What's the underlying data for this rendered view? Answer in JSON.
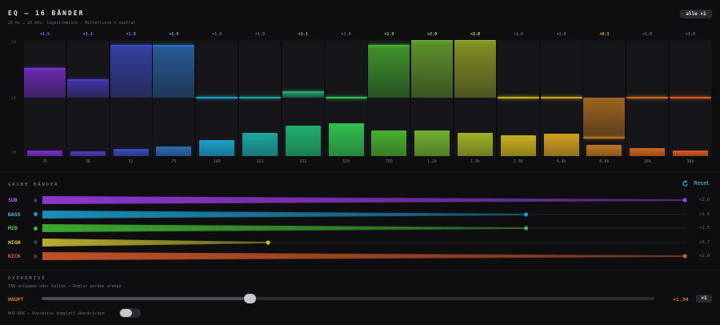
{
  "header": {
    "title": "EQ — 16 BÄNDER",
    "subtitle": "20 Hz … 20 kHz, logarithmisch — Mittellinie = neutral",
    "all_button": "alle ×1"
  },
  "eq": {
    "axis": {
      "top": "×2",
      "mid": "×1",
      "bottom": "×0"
    },
    "bands": [
      {
        "freq": "25",
        "gain": 1.5,
        "gain_label": "×1.5",
        "meter": 0.05,
        "color": "#7b2fd0",
        "label_color": "#a66bff"
      },
      {
        "freq": "36",
        "gain": 1.3,
        "gain_label": "×1.3",
        "meter": 0.04,
        "color": "#4a3cc0",
        "label_color": "#8a7bff"
      },
      {
        "freq": "52",
        "gain": 1.9,
        "gain_label": "×1.9",
        "meter": 0.06,
        "color": "#3a4bbf",
        "label_color": "#7a8cff"
      },
      {
        "freq": "75",
        "gain": 1.9,
        "gain_label": "×1.9",
        "meter": 0.08,
        "color": "#2a6bb5",
        "label_color": "#5ab0f0"
      },
      {
        "freq": "140",
        "gain": 1.0,
        "gain_label": "×1.0",
        "meter": 0.14,
        "color": "#1aa0c8",
        "label_color": "#6b6b75"
      },
      {
        "freq": "221",
        "gain": 1.0,
        "gain_label": "×1.0",
        "meter": 0.2,
        "color": "#1aa8a0",
        "label_color": "#6b6b75"
      },
      {
        "freq": "331",
        "gain": 1.1,
        "gain_label": "×1.1",
        "meter": 0.26,
        "color": "#20b070",
        "label_color": "#5ae09a"
      },
      {
        "freq": "510",
        "gain": 1.0,
        "gain_label": "×1.0",
        "meter": 0.28,
        "color": "#30c050",
        "label_color": "#6b6b75"
      },
      {
        "freq": "785",
        "gain": 1.9,
        "gain_label": "×1.9",
        "meter": 0.22,
        "color": "#48b030",
        "label_color": "#7ae050"
      },
      {
        "freq": "1.2k",
        "gain": 2.0,
        "gain_label": "×2.0",
        "meter": 0.22,
        "color": "#70b030",
        "label_color": "#a0e050"
      },
      {
        "freq": "1.9k",
        "gain": 2.0,
        "gain_label": "×2.0",
        "meter": 0.2,
        "color": "#a0b028",
        "label_color": "#d0e050"
      },
      {
        "freq": "2.9k",
        "gain": 1.0,
        "gain_label": "×1.0",
        "meter": 0.18,
        "color": "#c8b020",
        "label_color": "#6b6b75"
      },
      {
        "freq": "4.4k",
        "gain": 1.0,
        "gain_label": "×1.0",
        "meter": 0.19,
        "color": "#d0a020",
        "label_color": "#6b6b75"
      },
      {
        "freq": "6.8k",
        "gain": 0.3,
        "gain_label": "×0.3",
        "meter": 0.1,
        "color": "#c07820",
        "label_color": "#f0a030"
      },
      {
        "freq": "10k",
        "gain": 1.0,
        "gain_label": "×1.0",
        "meter": 0.07,
        "color": "#d06820",
        "label_color": "#6b6b75"
      },
      {
        "freq": "16k",
        "gain": 1.0,
        "gain_label": "×1.0",
        "meter": 0.05,
        "color": "#e05a20",
        "label_color": "#6b6b75"
      }
    ]
  },
  "groups": {
    "title": "GROBE BÄNDER",
    "reset_label": "Reset",
    "reset_color": "#4fc3e8",
    "rows": [
      {
        "label": "SUB",
        "value": 2.0,
        "value_label": "×2.0",
        "color": "#9a3ae0",
        "label_color": "#b060ff",
        "dot": "#3a3a42"
      },
      {
        "label": "BASS",
        "value": 1.5,
        "value_label": "×1.5",
        "color": "#1a9ac8",
        "label_color": "#4fb8e8",
        "dot": "#1a9ac8"
      },
      {
        "label": "MID",
        "value": 1.5,
        "value_label": "×1.5",
        "color": "#40b830",
        "label_color": "#60d850",
        "dot": "#40b830"
      },
      {
        "label": "HIGH",
        "value": 0.7,
        "value_label": "×0.7",
        "color": "#c8c030",
        "label_color": "#e0d850",
        "dot": "#3a3a42"
      },
      {
        "label": "KICK",
        "value": 2.0,
        "value_label": "×2.0",
        "color": "#d0582a",
        "label_color": "#e8683a",
        "dot": "#3a3a42"
      }
    ]
  },
  "overdrive": {
    "title": "OVERDRIVE",
    "subtitle": "TAB antippen oder halten → Regler werden orange",
    "main_label": "HAUPT",
    "value": 1.34,
    "value_label": "×1.34",
    "reset_button": "×1",
    "hot_label": "HOT-AUX — Overdrive komplett überbrücken",
    "hot_enabled": false
  }
}
